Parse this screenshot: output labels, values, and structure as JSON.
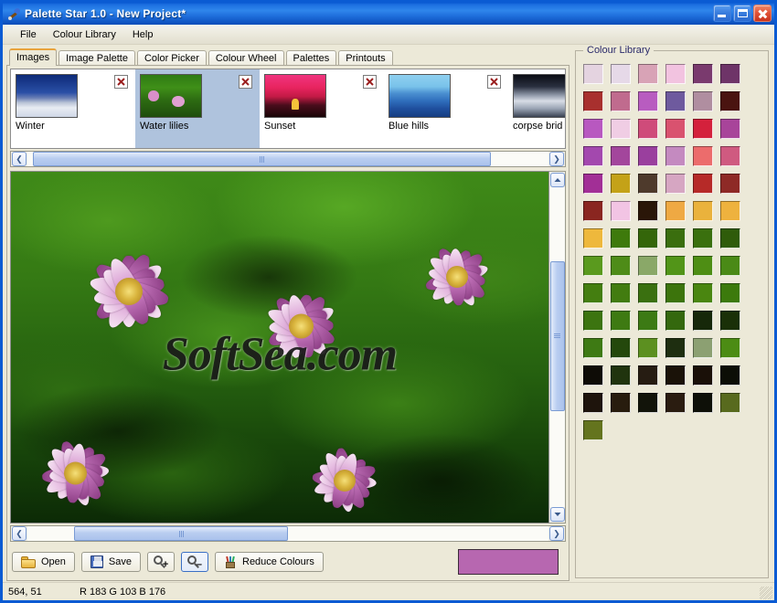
{
  "window": {
    "title": "Palette Star 1.0 - New Project*",
    "icon": "palette-brush-icon",
    "caption_buttons": {
      "minimize": "minimize-button",
      "maximize": "maximize-button",
      "close": "close-button"
    }
  },
  "menubar": {
    "items": [
      {
        "label": "File"
      },
      {
        "label": "Colour Library"
      },
      {
        "label": "Help"
      }
    ]
  },
  "tabs": [
    {
      "label": "Images",
      "active": true
    },
    {
      "label": "Image Palette",
      "active": false
    },
    {
      "label": "Color Picker",
      "active": false
    },
    {
      "label": "Colour Wheel",
      "active": false
    },
    {
      "label": "Palettes",
      "active": false
    },
    {
      "label": "Printouts",
      "active": false
    }
  ],
  "thumbnails": [
    {
      "label": "Winter",
      "art": "art-winter",
      "selected": false,
      "close_icon": "close-thumbnail-icon"
    },
    {
      "label": "Water lilies",
      "art": "art-lilies",
      "selected": true,
      "close_icon": "close-thumbnail-icon"
    },
    {
      "label": "Sunset",
      "art": "art-sunset",
      "selected": false,
      "close_icon": "close-thumbnail-icon"
    },
    {
      "label": "Blue hills",
      "art": "art-hills",
      "selected": false,
      "close_icon": "close-thumbnail-icon"
    },
    {
      "label": "corpse brid",
      "art": "art-bride",
      "selected": false,
      "close_icon": "close-thumbnail-icon"
    }
  ],
  "thumb_scroll": {
    "left_arrow": "❮",
    "right_arrow": "❯",
    "thumb_left_pct": 1,
    "thumb_width_pct": 88
  },
  "viewer": {
    "watermark": "SoftSea.com",
    "hscroll": {
      "left_arrow": "❮",
      "right_arrow": "❯",
      "thumb_left_pct": 9,
      "thumb_width_pct": 41
    },
    "vscroll": {
      "up_arrow": "▲",
      "down_arrow": "▼",
      "thumb_top_pct": 23,
      "thumb_height_pct": 47
    }
  },
  "toolbar": {
    "open_label": "Open",
    "save_label": "Save",
    "zoom_in_label": "",
    "zoom_out_label": "",
    "reduce_label": "Reduce Colours",
    "icons": {
      "open": "folder-open-icon",
      "save": "floppy-disk-icon",
      "zoom_in": "magnifier-plus-icon",
      "zoom_out": "magnifier-minus-icon",
      "reduce": "paint-brushes-icon"
    },
    "preview_color": "#b767b0"
  },
  "colour_library": {
    "title": "Colour Library",
    "swatches": [
      "#e4d3e0",
      "#e6d9e8",
      "#d8a3b6",
      "#f2c3e0",
      "#7a3a6e",
      "#6e3468",
      "#a8302e",
      "#c06b8e",
      "#b85cc0",
      "#6e5a9e",
      "#b08ea0",
      "#4a1410",
      "#b858c0",
      "#f0cde4",
      "#cf4b7a",
      "#d9526f",
      "#d4213c",
      "#a8449a",
      "#a348ae",
      "#a3469c",
      "#9a3f9e",
      "#c48ac0",
      "#ec6c6c",
      "#cf5a80",
      "#a22f96",
      "#c4a218",
      "#4e3a2c",
      "#d6a6c2",
      "#b62a28",
      "#8e2a26",
      "#8a2620",
      "#f2c4e4",
      "#2a1608",
      "#efa943",
      "#eab23c",
      "#eeb23e",
      "#eeb83c",
      "#3e7a0c",
      "#34660a",
      "#3a6e0e",
      "#3a700e",
      "#2f5c0a",
      "#5a9a1e",
      "#4e8c18",
      "#8aa868",
      "#529518",
      "#4e8e14",
      "#4a8a16",
      "#447e10",
      "#427c10",
      "#3a7010",
      "#3c740c",
      "#4a8610",
      "#3c7a0c",
      "#3c7410",
      "#3e7a12",
      "#3c7a14",
      "#34680e",
      "#16280a",
      "#1a3008",
      "#3e7a14",
      "#24480c",
      "#5c9020",
      "#1e2e10",
      "#8ca072",
      "#4c8c14",
      "#0e0c06",
      "#20340e",
      "#261c12",
      "#1a1208",
      "#1a1008",
      "#0c0e06",
      "#1e140c",
      "#281c0e",
      "#12140a",
      "#2a1c10",
      "#0e1008",
      "#586a1e",
      "#64741e"
    ]
  },
  "statusbar": {
    "position": "564, 51",
    "rgb": "R 183 G 103 B 176"
  }
}
